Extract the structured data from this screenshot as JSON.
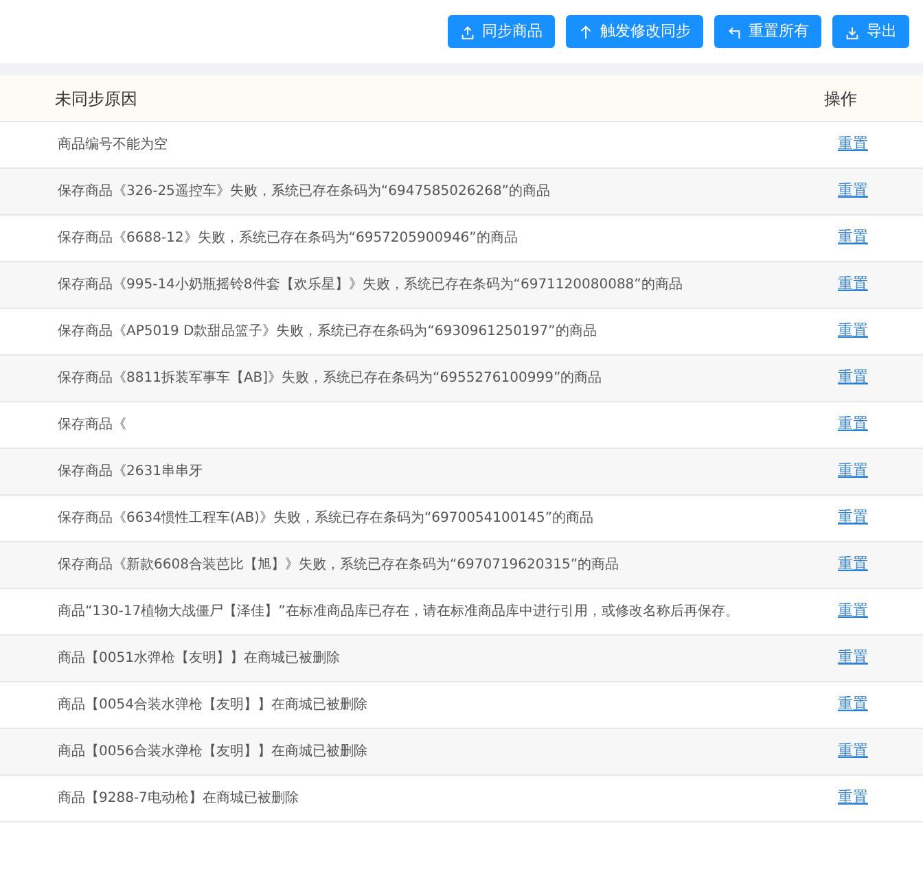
{
  "toolbar": [
    {
      "label": "同步商品",
      "kind": "upload"
    },
    {
      "label": "触发修改同步",
      "kind": "trigger"
    },
    {
      "label": "重置所有",
      "kind": "reset"
    },
    {
      "label": "导出",
      "kind": "export"
    }
  ],
  "table": {
    "columns": [
      "未同步原因",
      "操作"
    ],
    "rows": [
      {
        "reason": "商品编号不能为空",
        "action": "重置"
      },
      {
        "reason": "保存商品《326-25遥控车》失败，系统已存在条码为“6947585026268”的商品",
        "action": "重置"
      },
      {
        "reason": "保存商品《6688-12》失败，系统已存在条码为“6957205900946”的商品",
        "action": "重置"
      },
      {
        "reason": "保存商品《995-14小奶瓶摇铃8件套【欢乐星】》失败，系统已存在条码为“6971120080088”的商品",
        "action": "重置"
      },
      {
        "reason": "保存商品《AP5019 D款甜品篮子》失败，系统已存在条码为“6930961250197”的商品",
        "action": "重置"
      },
      {
        "reason": "保存商品《8811拆装军事车【AB]》失败，系统已存在条码为“6955276100999”的商品",
        "action": "重置"
      },
      {
        "reason": "保存商品《",
        "action": "重置"
      },
      {
        "reason": "保存商品《2631串串牙",
        "action": "重置"
      },
      {
        "reason": "保存商品《6634惯性工程车(AB)》失败，系统已存在条码为“6970054100145”的商品",
        "action": "重置"
      },
      {
        "reason": "保存商品《新款6608合装芭比【旭】》失败，系统已存在条码为“6970719620315”的商品",
        "action": "重置"
      },
      {
        "reason": "商品“130-17植物大战僵尸【泽佳】”在标准商品库已存在，请在标准商品库中进行引用，或修改名称后再保存。",
        "action": "重置"
      },
      {
        "reason": "商品【0051水弹枪【友明】】在商城已被删除",
        "action": "重置"
      },
      {
        "reason": "商品【0054合装水弹枪【友明】】在商城已被删除",
        "action": "重置"
      },
      {
        "reason": "商品【0056合装水弹枪【友明】】在商城已被删除",
        "action": "重置"
      },
      {
        "reason": "商品【9288-7电动枪】在商城已被删除",
        "action": "重置"
      }
    ]
  }
}
